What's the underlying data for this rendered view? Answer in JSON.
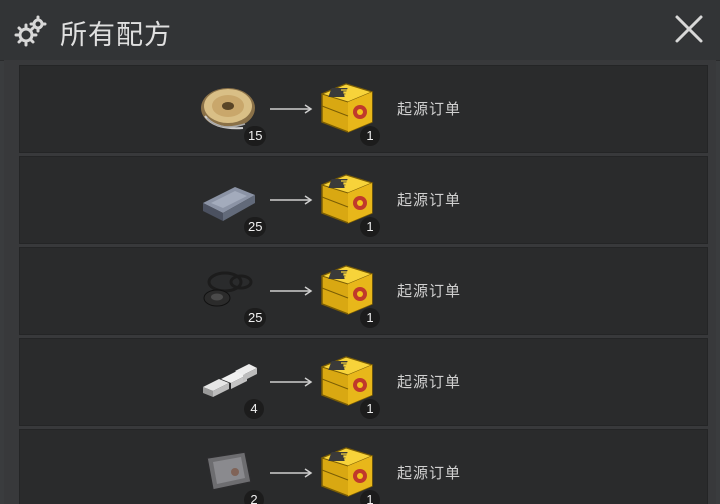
{
  "header": {
    "title": "所有配方",
    "icon": "gears-icon",
    "close_icon": "close-icon"
  },
  "recipes": [
    {
      "ingredient": "wire-spool-icon",
      "ingredient_count": "15",
      "result": "origin-order-crate-icon",
      "result_count": "1",
      "label": "起源订单"
    },
    {
      "ingredient": "metal-ingot-icon",
      "ingredient_count": "25",
      "result": "origin-order-crate-icon",
      "result_count": "1",
      "label": "起源订单"
    },
    {
      "ingredient": "rubber-rings-icon",
      "ingredient_count": "25",
      "result": "origin-order-crate-icon",
      "result_count": "1",
      "label": "起源订单"
    },
    {
      "ingredient": "aluminum-bars-icon",
      "ingredient_count": "4",
      "result": "origin-order-crate-icon",
      "result_count": "1",
      "label": "起源订单"
    },
    {
      "ingredient": "metal-plate-icon",
      "ingredient_count": "2",
      "result": "origin-order-crate-icon",
      "result_count": "1",
      "label": "起源订单"
    }
  ],
  "colors": {
    "background": "#3a3c3e",
    "row": "#2a2b2c",
    "crate_yellow": "#f2c41c",
    "crate_red": "#c0392b"
  }
}
